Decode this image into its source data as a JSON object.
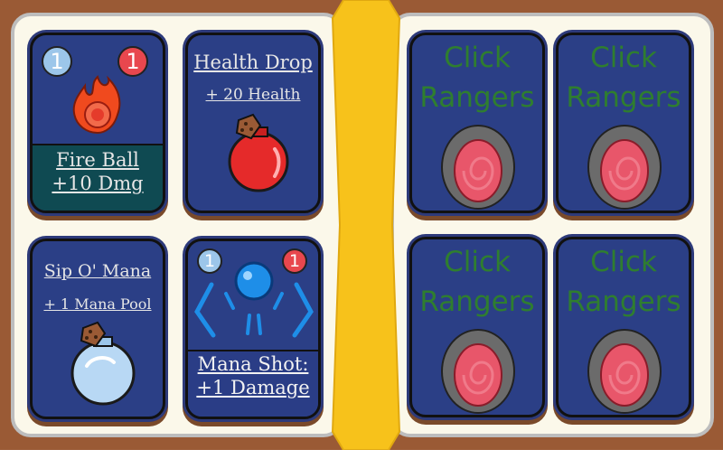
{
  "left_page": {
    "fire_ball": {
      "cost": "1",
      "power": "1",
      "name": "Fire Ball",
      "effect": "+10 Dmg"
    },
    "health_drop": {
      "name": "Health Drop",
      "effect": "+ 20 Health"
    },
    "sip_o_mana": {
      "name": "Sip O' Mana",
      "effect": "+ 1 Mana Pool"
    },
    "mana_shot": {
      "cost": "1",
      "power": "1",
      "name": "Mana Shot:",
      "effect": "+1 Damage"
    }
  },
  "right_page": {
    "card_backs": [
      {
        "line1": "Click",
        "line2": "Rangers"
      },
      {
        "line1": "Click",
        "line2": "Rangers"
      },
      {
        "line1": "Click",
        "line2": "Rangers"
      },
      {
        "line1": "Click",
        "line2": "Rangers"
      }
    ]
  },
  "colors": {
    "book_cover": "#9a5a35",
    "page": "#fbf8ea",
    "spine": "#f7c21b",
    "card_face": "#2b3f86",
    "fire_footer": "#0f4a52",
    "click_text": "#2f7e2f"
  },
  "icons": {
    "fire_ball": "fireball-icon",
    "health_drop": "red-potion-icon",
    "sip_o_mana": "blue-potion-icon",
    "mana_shot": "mana-orb-icon",
    "card_back": "portal-icon"
  }
}
